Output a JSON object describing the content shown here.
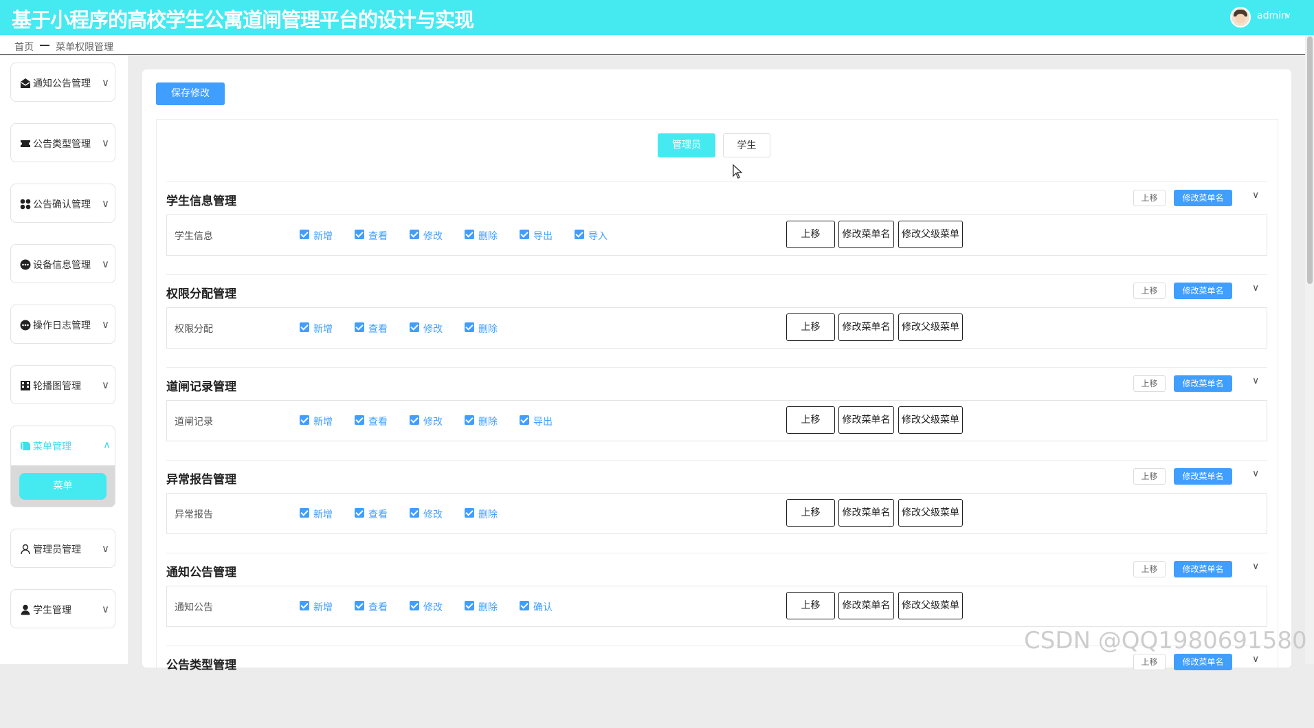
{
  "header": {
    "title": "基于小程序的高校学生公寓道闸管理平台的设计与实现",
    "user": "admin",
    "caret": "∨"
  },
  "breadcrumb": {
    "home": "首页",
    "current": "菜单权限管理"
  },
  "sidebar": {
    "chevron_down": "∨",
    "chevron_up": "∧",
    "items": [
      {
        "label": "通知公告管理",
        "icon": "envelope-icon"
      },
      {
        "label": "公告类型管理",
        "icon": "ticket-icon"
      },
      {
        "label": "公告确认管理",
        "icon": "grid-icon"
      },
      {
        "label": "设备信息管理",
        "icon": "dots-icon"
      },
      {
        "label": "操作日志管理",
        "icon": "dots-icon"
      },
      {
        "label": "轮播图管理",
        "icon": "building-icon"
      },
      {
        "label": "菜单管理",
        "icon": "book-icon",
        "expanded": true,
        "sub": "菜单"
      },
      {
        "label": "管理员管理",
        "icon": "user-outline-icon"
      },
      {
        "label": "学生管理",
        "icon": "user-solid-icon"
      }
    ]
  },
  "toolbar": {
    "save_label": "保存修改"
  },
  "roles": {
    "active": "管理员",
    "inactive": "学生"
  },
  "group_actions": {
    "up": "上移",
    "rename": "修改菜单名",
    "chevron": "∨"
  },
  "row_actions": {
    "up": "上移",
    "rename": "修改菜单名",
    "reparent": "修改父级菜单"
  },
  "groups": [
    {
      "title": "学生信息管理",
      "row": "学生信息",
      "perms": [
        "新增",
        "查看",
        "修改",
        "删除",
        "导出",
        "导入"
      ]
    },
    {
      "title": "权限分配管理",
      "row": "权限分配",
      "perms": [
        "新增",
        "查看",
        "修改",
        "删除"
      ]
    },
    {
      "title": "道闸记录管理",
      "row": "道闸记录",
      "perms": [
        "新增",
        "查看",
        "修改",
        "删除",
        "导出"
      ]
    },
    {
      "title": "异常报告管理",
      "row": "异常报告",
      "perms": [
        "新增",
        "查看",
        "修改",
        "删除"
      ]
    },
    {
      "title": "通知公告管理",
      "row": "通知公告",
      "perms": [
        "新增",
        "查看",
        "修改",
        "删除",
        "确认"
      ]
    },
    {
      "title": "公告类型管理",
      "row": "",
      "perms": []
    }
  ],
  "watermark": "CSDN @QQ1980691580",
  "colors": {
    "header": "#45eaf1",
    "primary": "#409eff",
    "active_menu": "#45dde8"
  }
}
